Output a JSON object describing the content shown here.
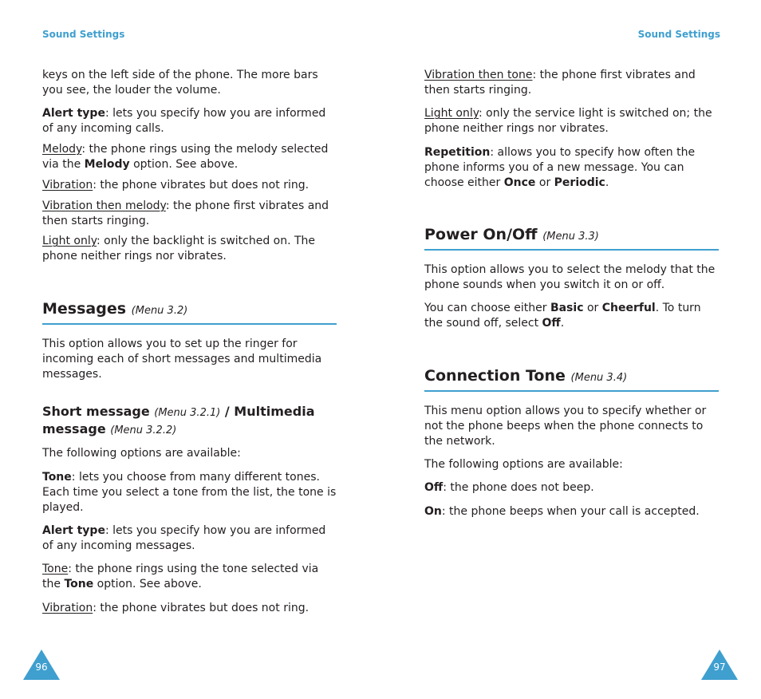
{
  "running_head": "Sound Settings",
  "accent_color": "#3f9fcf",
  "left_page": {
    "page_number": "96",
    "intro": "keys on the left side of the phone. The more bars you see, the louder the volume.",
    "alert_type": {
      "term": "Alert type",
      "text": ": lets you specify how you are informed of any incoming calls."
    },
    "melody": {
      "term": "Melody",
      "text_a": ": the phone rings using the melody selected via the ",
      "bold": "Melody",
      "text_b": " option. See above."
    },
    "vibration": {
      "term": "Vibration",
      "text": ": the phone vibrates but does not ring."
    },
    "vibration_then_melody": {
      "term": "Vibration then melody",
      "text": ": the phone first vibrates and then starts ringing."
    },
    "light_only": {
      "term": "Light only",
      "text": ": only the backlight is switched on. The phone neither rings nor vibrates."
    },
    "messages_heading": {
      "title": "Messages",
      "menu": "(Menu 3.2)"
    },
    "messages_intro": "This option allows you to set up the ringer for incoming each of short messages and multimedia messages.",
    "sub_heading": {
      "part1": "Short message",
      "menu1": "(Menu 3.2.1)",
      "sep": " / Multimedia",
      "part2": "message",
      "menu2": "(Menu 3.2.2)"
    },
    "options_available": "The following options are available:",
    "tone": {
      "term": "Tone",
      "text": ": lets you choose from many different tones. Each time you select a tone from the list, the tone is played."
    },
    "alert_type_msg": {
      "term": "Alert type",
      "text": ": lets you specify how you are informed of any incoming messages."
    },
    "tone_alert": {
      "term": "Tone",
      "text_a": ": the phone rings using the tone selected via the ",
      "bold": "Tone",
      "text_b": " option. See above."
    },
    "vibration_msg": {
      "term": "Vibration",
      "text": ": the phone vibrates but does not ring."
    }
  },
  "right_page": {
    "page_number": "97",
    "vibration_then_tone": {
      "term": "Vibration then tone",
      "text": ": the phone first vibrates and then starts ringing."
    },
    "light_only": {
      "term": "Light only",
      "text": ": only the service light is switched on; the phone neither rings nor vibrates."
    },
    "repetition": {
      "term": "Repetition",
      "text_a": ": allows you to specify how often the phone informs you of a new message. You can choose either ",
      "bold1": "Once",
      "text_b": " or ",
      "bold2": "Periodic",
      "text_c": "."
    },
    "power_heading": {
      "title": "Power On/Off",
      "menu": "(Menu 3.3)"
    },
    "power_intro": "This option allows you to select the melody that the phone sounds when you switch it on or off.",
    "power_choice": {
      "text_a": "You can choose either ",
      "bold1": "Basic",
      "text_b": " or ",
      "bold2": "Cheerful",
      "text_c": ". To turn the sound off, select ",
      "bold3": "Off",
      "text_d": "."
    },
    "connection_heading": {
      "title": "Connection Tone",
      "menu": "(Menu 3.4)"
    },
    "connection_intro": "This menu option allows you to specify whether or not the phone beeps when the phone connects to the network.",
    "options_available": "The following options are available:",
    "off": {
      "term": "Off",
      "text": ": the phone does not beep."
    },
    "on": {
      "term": "On",
      "text": ": the phone beeps when your call is accepted."
    }
  }
}
